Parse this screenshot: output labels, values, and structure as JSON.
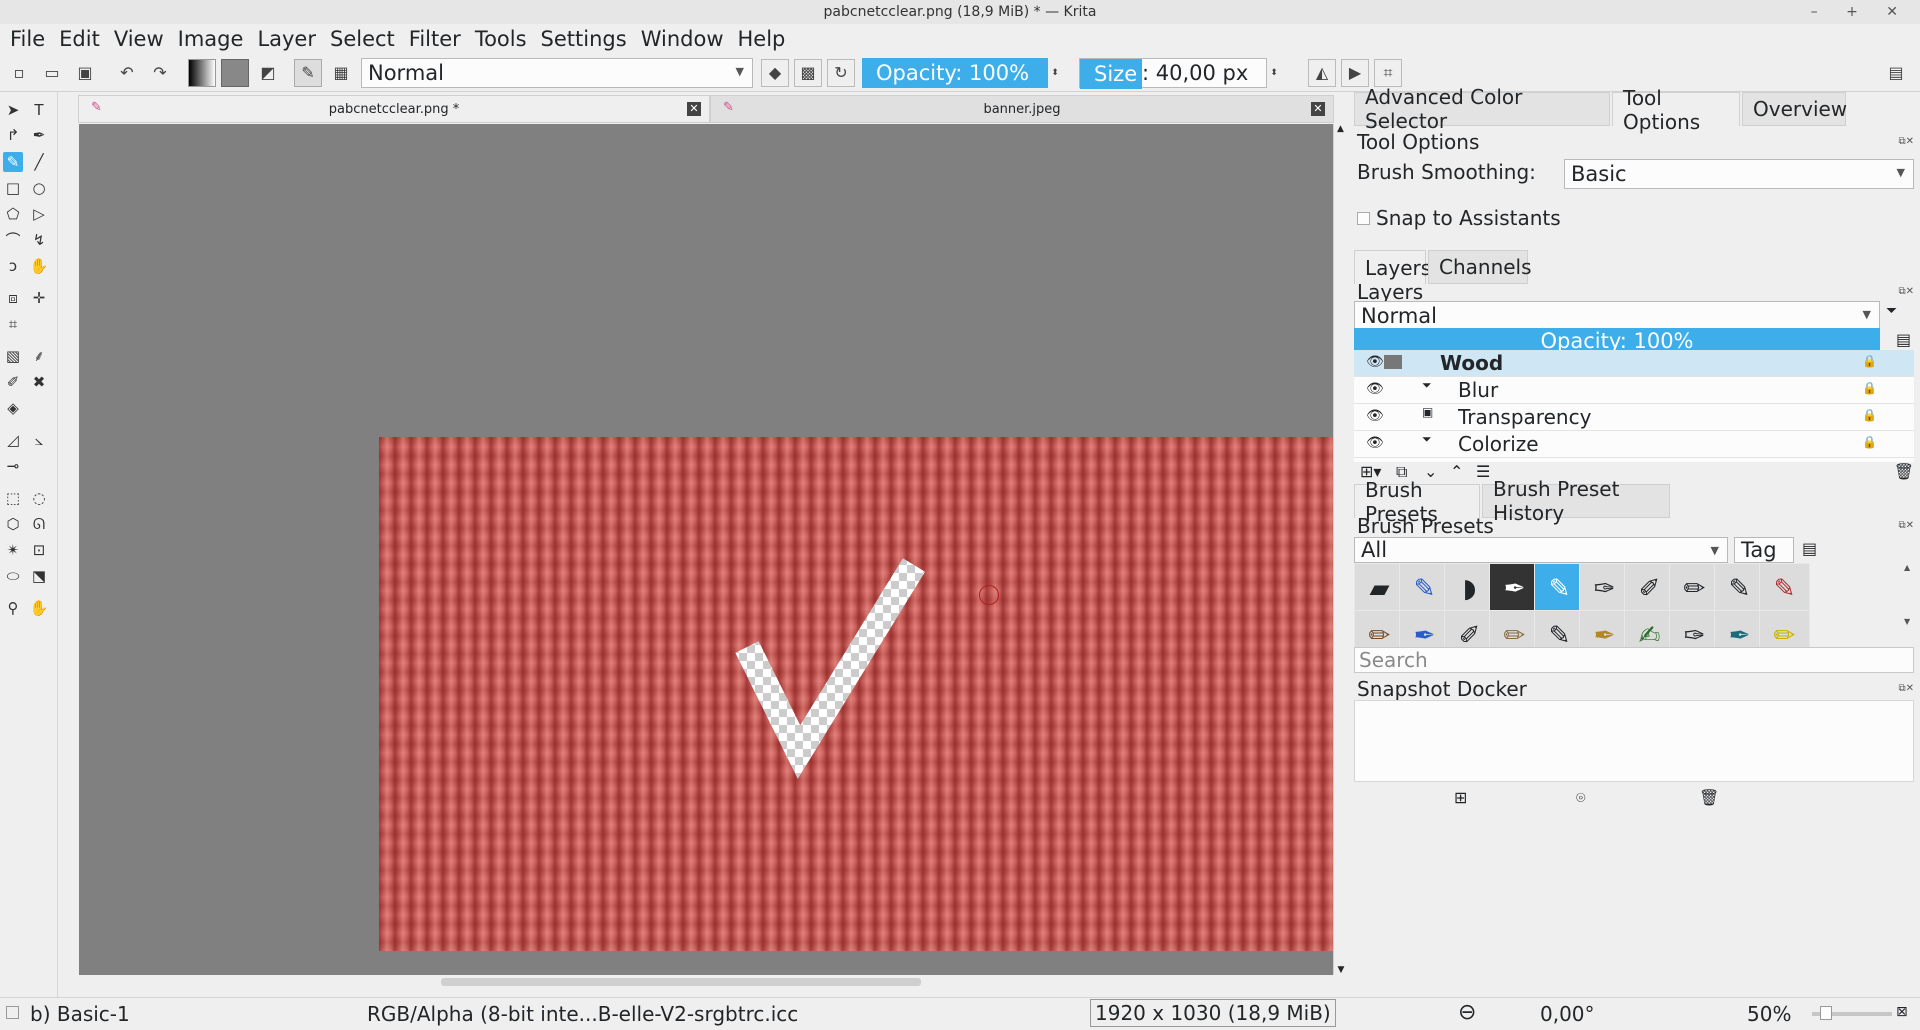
{
  "window": {
    "title": "pabcnetcclear.png (18,9 MiB) * — Krita",
    "controls": "– + ✕"
  },
  "menu": [
    "File",
    "Edit",
    "View",
    "Image",
    "Layer",
    "Select",
    "Filter",
    "Tools",
    "Settings",
    "Window",
    "Help"
  ],
  "toolbar": {
    "blend_mode": "Normal",
    "opacity": "Opacity: 100%",
    "size_label": "Size",
    "size_value": ": 40,00 px"
  },
  "tabs": [
    {
      "label": "pabcnetcclear.png *",
      "active": true
    },
    {
      "label": "banner.jpeg",
      "active": false
    }
  ],
  "dock": {
    "top_tabs": [
      "Advanced Color Selector",
      "Tool Options",
      "Overview"
    ],
    "tool_options": {
      "title": "Tool Options",
      "brush_smoothing_label": "Brush Smoothing:",
      "brush_smoothing_value": "Basic",
      "snap_label": "Snap to Assistants"
    },
    "layer_tabs": [
      "Layers",
      "Channels"
    ],
    "layers": {
      "title": "Layers",
      "blend_mode": "Normal",
      "opacity": "Opacity:  100%",
      "items": [
        {
          "name": "Wood",
          "selected": true,
          "child": false
        },
        {
          "name": "Blur",
          "selected": false,
          "child": true
        },
        {
          "name": "Transparency",
          "selected": false,
          "child": true
        },
        {
          "name": "Colorize",
          "selected": false,
          "child": true
        }
      ]
    },
    "preset_tabs": [
      "Brush Presets",
      "Brush Preset History"
    ],
    "presets": {
      "title": "Brush Presets",
      "filter": "All",
      "tag": "Tag",
      "search_placeholder": "Search"
    },
    "snapshot": {
      "title": "Snapshot Docker"
    }
  },
  "status": {
    "brush": "b) Basic-1",
    "color_profile": "RGB/Alpha (8-bit inte...B-elle-V2-srgbtrc.icc",
    "image_size": "1920 x 1030 (18,9 MiB)",
    "rotation": "0,00°",
    "zoom": "50%"
  },
  "colors": {
    "accent": "#3daee9",
    "canvas_bg": "#808080",
    "artwork": "#d35a55"
  }
}
